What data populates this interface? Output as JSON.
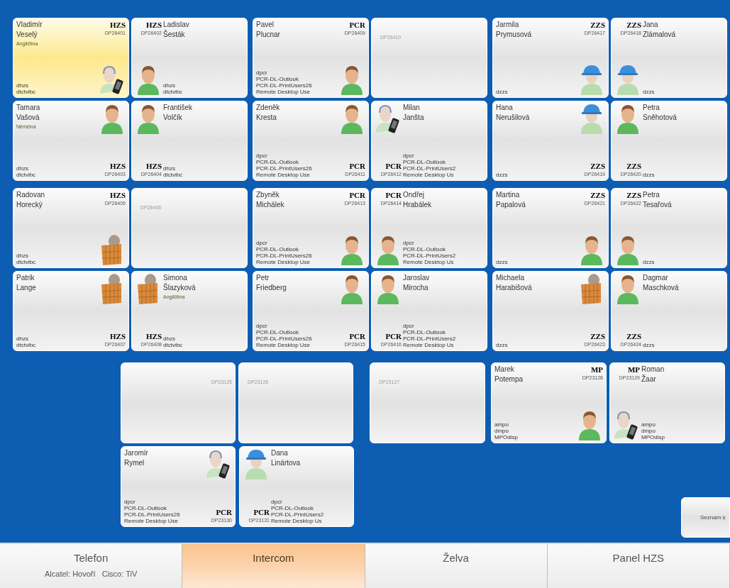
{
  "upper_rows": [
    [
      {
        "kind": "headset_phone",
        "first_name": "Vladimír",
        "last_name": "Veselý",
        "language": "Angličtina",
        "unit": "HZS",
        "extension": "DP26401",
        "groups": [
          "dhzs",
          "dtctvibc"
        ],
        "mirrored": false,
        "badge_at_bottom": false,
        "selected": true
      },
      {
        "kind": "person",
        "first_name": "Ladislav",
        "last_name": "Šesták",
        "unit": "HZS",
        "extension": "DP26402",
        "groups": [
          "dhzs",
          "dtctvibc"
        ],
        "mirrored": true,
        "badge_at_bottom": false,
        "selected": false
      },
      {
        "kind": "person",
        "first_name": "Pavel",
        "last_name": "Plucnar",
        "unit": "PCR",
        "extension": "DP26409",
        "groups": [
          "dpcr",
          "PCR-DL-Outlook",
          "PCR-DL-PrintUsers26",
          "Remote Desktop Use"
        ],
        "mirrored": false,
        "badge_at_bottom": false,
        "selected": false
      },
      {
        "kind": "empty",
        "extension": "DP26410",
        "mirrored": false
      },
      {
        "kind": "helmet",
        "first_name": "Jarmila",
        "last_name": "Prymusová",
        "unit": "ZZS",
        "extension": "DP26417",
        "groups": [
          "dzzs"
        ],
        "mirrored": false,
        "badge_at_bottom": false,
        "selected": false
      },
      {
        "kind": "helmet",
        "first_name": "Jana",
        "last_name": "Zlámalová",
        "unit": "ZZS",
        "extension": "DP26418",
        "groups": [
          "dzzs"
        ],
        "mirrored": true,
        "badge_at_bottom": false,
        "selected": false
      }
    ],
    [
      {
        "kind": "person",
        "first_name": "Tamara",
        "last_name": "Vašová",
        "language": "Němčina",
        "unit": "HZS",
        "extension": "DP26403",
        "groups": [
          "dhzs",
          "dtctvibc"
        ],
        "mirrored": false,
        "badge_at_bottom": true,
        "selected": false
      },
      {
        "kind": "person",
        "first_name": "František",
        "last_name": "Volčík",
        "unit": "HZS",
        "extension": "DP26404",
        "groups": [
          "dhzs",
          "dtctvibc"
        ],
        "mirrored": true,
        "badge_at_bottom": true,
        "selected": false
      },
      {
        "kind": "person",
        "first_name": "Zdeněk",
        "last_name": "Kresta",
        "unit": "PCR",
        "extension": "DP26411",
        "groups": [
          "dpcr",
          "PCR-DL-Outlook",
          "PCR-DL-PrintUsers26",
          "Remote Desktop Use"
        ],
        "mirrored": false,
        "badge_at_bottom": true,
        "selected": false
      },
      {
        "kind": "headset_phone",
        "first_name": "Milan",
        "last_name": "Janšta",
        "unit": "PCR",
        "extension": "DP26412",
        "groups": [
          "dpcr",
          "PCR-DL-Outlook",
          "PCR-DL-PrintUsers2",
          "Remote Desktop Us"
        ],
        "mirrored": true,
        "badge_at_bottom": true,
        "selected": false
      },
      {
        "kind": "helmet",
        "first_name": "Hana",
        "last_name": "Nerušilová",
        "unit": "ZZS",
        "extension": "DP26419",
        "groups": [
          "dzzs"
        ],
        "mirrored": false,
        "badge_at_bottom": true,
        "selected": false
      },
      {
        "kind": "person",
        "first_name": "Petra",
        "last_name": "Sněhotová",
        "unit": "ZZS",
        "extension": "DP26420",
        "groups": [
          "dzzs"
        ],
        "mirrored": true,
        "badge_at_bottom": true,
        "selected": false
      }
    ],
    [
      {
        "kind": "box",
        "first_name": "Radovan",
        "last_name": "Horecký",
        "unit": "HZS",
        "extension": "DP26405",
        "groups": [
          "dhzs",
          "dtctvibc"
        ],
        "mirrored": false,
        "badge_at_bottom": false,
        "selected": false
      },
      {
        "kind": "empty",
        "extension": "DP26406",
        "mirrored": false
      },
      {
        "kind": "person",
        "first_name": "Zbyněk",
        "last_name": "Michálek",
        "unit": "PCR",
        "extension": "DP26413",
        "groups": [
          "dpcr",
          "PCR-DL-Outlook",
          "PCR-DL-PrintUsers26",
          "Remote Desktop Use"
        ],
        "mirrored": false,
        "badge_at_bottom": false,
        "selected": false
      },
      {
        "kind": "person",
        "first_name": "Ondřej",
        "last_name": "Hrabálek",
        "unit": "PCR",
        "extension": "DP26414",
        "groups": [
          "dpcr",
          "PCR-DL-Outlook",
          "PCR-DL-PrintUsers2",
          "Remote Desktop Us"
        ],
        "mirrored": true,
        "badge_at_bottom": false,
        "selected": false
      },
      {
        "kind": "person",
        "first_name": "Martina",
        "last_name": "Papalová",
        "unit": "ZZS",
        "extension": "DP26421",
        "groups": [
          "dzzs"
        ],
        "mirrored": false,
        "badge_at_bottom": false,
        "selected": false
      },
      {
        "kind": "person",
        "first_name": "Petra",
        "last_name": "Tesařová",
        "unit": "ZZS",
        "extension": "DP26422",
        "groups": [
          "dzzs"
        ],
        "mirrored": true,
        "badge_at_bottom": false,
        "selected": false
      }
    ],
    [
      {
        "kind": "box",
        "first_name": "Patrik",
        "last_name": "Lange",
        "unit": "HZS",
        "extension": "DP26407",
        "groups": [
          "dhzs",
          "dtctvibc"
        ],
        "mirrored": false,
        "badge_at_bottom": true,
        "selected": false
      },
      {
        "kind": "box",
        "first_name": "Simona",
        "last_name": "Šlazyková",
        "language": "Angličtina",
        "unit": "HZS",
        "extension": "DP26408",
        "groups": [
          "dhzs",
          "dtctvibc"
        ],
        "mirrored": true,
        "badge_at_bottom": true,
        "selected": false
      },
      {
        "kind": "person",
        "first_name": "Petr",
        "last_name": "Friedberg",
        "unit": "PCR",
        "extension": "DP26415",
        "groups": [
          "dpcr",
          "PCR-DL-Outlook",
          "PCR-DL-PrintUsers26",
          "Remote Desktop Use"
        ],
        "mirrored": false,
        "badge_at_bottom": true,
        "selected": false
      },
      {
        "kind": "person",
        "first_name": "Jaroslav",
        "last_name": "Mirocha",
        "unit": "PCR",
        "extension": "DP26416",
        "groups": [
          "dpcr",
          "PCR-DL-Outlook",
          "PCR-DL-PrintUsers2",
          "Remote Desktop Us"
        ],
        "mirrored": true,
        "badge_at_bottom": true,
        "selected": false
      },
      {
        "kind": "box",
        "first_name": "Michaela",
        "last_name": "Harabišová",
        "unit": "ZZS",
        "extension": "DP26423",
        "groups": [
          "dzzs"
        ],
        "mirrored": false,
        "badge_at_bottom": true,
        "selected": false
      },
      {
        "kind": "person",
        "first_name": "Dagmar",
        "last_name": "Maschková",
        "unit": "ZZS",
        "extension": "DP26424",
        "groups": [
          "dzzs"
        ],
        "mirrored": true,
        "badge_at_bottom": true,
        "selected": false
      }
    ]
  ],
  "lower_rows": [
    [
      {
        "kind": "empty",
        "extension": "DP23125",
        "mirrored": true
      },
      {
        "kind": "empty",
        "extension": "DP23126",
        "mirrored": false
      },
      {
        "kind": "empty",
        "extension": "DP23127",
        "mirrored": false
      },
      {
        "kind": "person",
        "first_name": "Marek",
        "last_name": "Potempa",
        "unit": "MP",
        "extension": "DP23128",
        "groups": [
          "ampo",
          "dmpo",
          "MPOdisp"
        ],
        "mirrored": false,
        "badge_at_bottom": false,
        "selected": false
      },
      {
        "kind": "headset_phone",
        "first_name": "Roman",
        "last_name": "Žaar",
        "unit": "MP",
        "extension": "DP23129",
        "groups": [
          "ampo",
          "dmpo",
          "MPOdisp"
        ],
        "mirrored": true,
        "badge_at_bottom": false,
        "selected": false
      }
    ],
    [
      {
        "kind": "headset_phone",
        "first_name": "Jaromír",
        "last_name": "Rymel",
        "unit": "PCR",
        "extension": "DP23130",
        "groups": [
          "dpcr",
          "PCR-DL-Outlook",
          "PCR-DL-PrintUsers26",
          "Remote Desktop Use"
        ],
        "mirrored": false,
        "badge_at_bottom": true,
        "selected": false
      },
      {
        "kind": "helmet",
        "first_name": "Dana",
        "last_name": "Linártova",
        "unit": "PCR",
        "extension": "DP23131",
        "groups": [
          "dpcr",
          "PCR-DL-Outlook",
          "PCR-DL-PrintUsers2",
          "Remote Desktop Us"
        ],
        "mirrored": true,
        "badge_at_bottom": true,
        "selected": false
      }
    ]
  ],
  "list_button": {
    "label": "Seznam s"
  },
  "tabs": [
    {
      "label": "Telefon",
      "status": "Alcatel: Hovoří   Cisco: TiV",
      "selected": false
    },
    {
      "label": "Intercom",
      "selected": true
    },
    {
      "label": "Želva",
      "selected": false
    },
    {
      "label": "Panel HZS",
      "selected": false
    }
  ]
}
